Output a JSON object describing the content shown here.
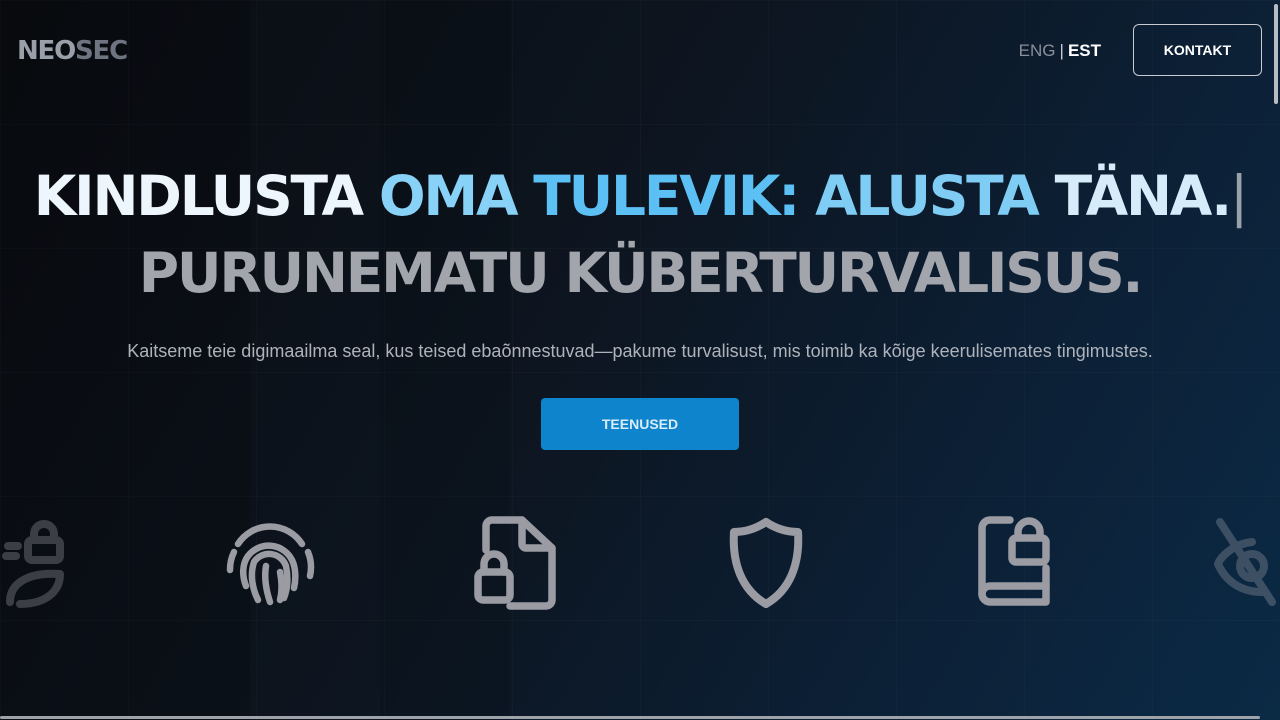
{
  "header": {
    "logo_part1": "NEO",
    "logo_part2": "SEC",
    "lang_eng": "ENG",
    "lang_sep": "|",
    "lang_est": "EST",
    "contact_label": "KONTAKT"
  },
  "hero": {
    "title_w1": "KINDLUSTA",
    "title_w2": "OMA",
    "title_w3": "TULEVIK:",
    "title_w4": "ALUSTA",
    "title_w5": "TÄNA.",
    "cursor": "|",
    "subtitle": "PURUNEMATU KÜBERTURVALISUS.",
    "tagline": "Kaitseme teie digimaailma seal, kus teised ebaõnnestuvad—pakume turvalisust, mis toimib ka kõige keerulisemates tingimustes.",
    "cta_label": "TEENUSED"
  },
  "icons": [
    "leaf-lock-icon",
    "fingerprint-icon",
    "locked-file-icon",
    "shield-icon",
    "locked-book-icon",
    "eye-slash-icon"
  ],
  "colors": {
    "accent": "#0d84cb",
    "title_light": "#eef6fd",
    "title_blue": "#5cc0f4",
    "subtitle_gray": "#a3a5ad",
    "icon_gray": "#9a9ba3"
  }
}
